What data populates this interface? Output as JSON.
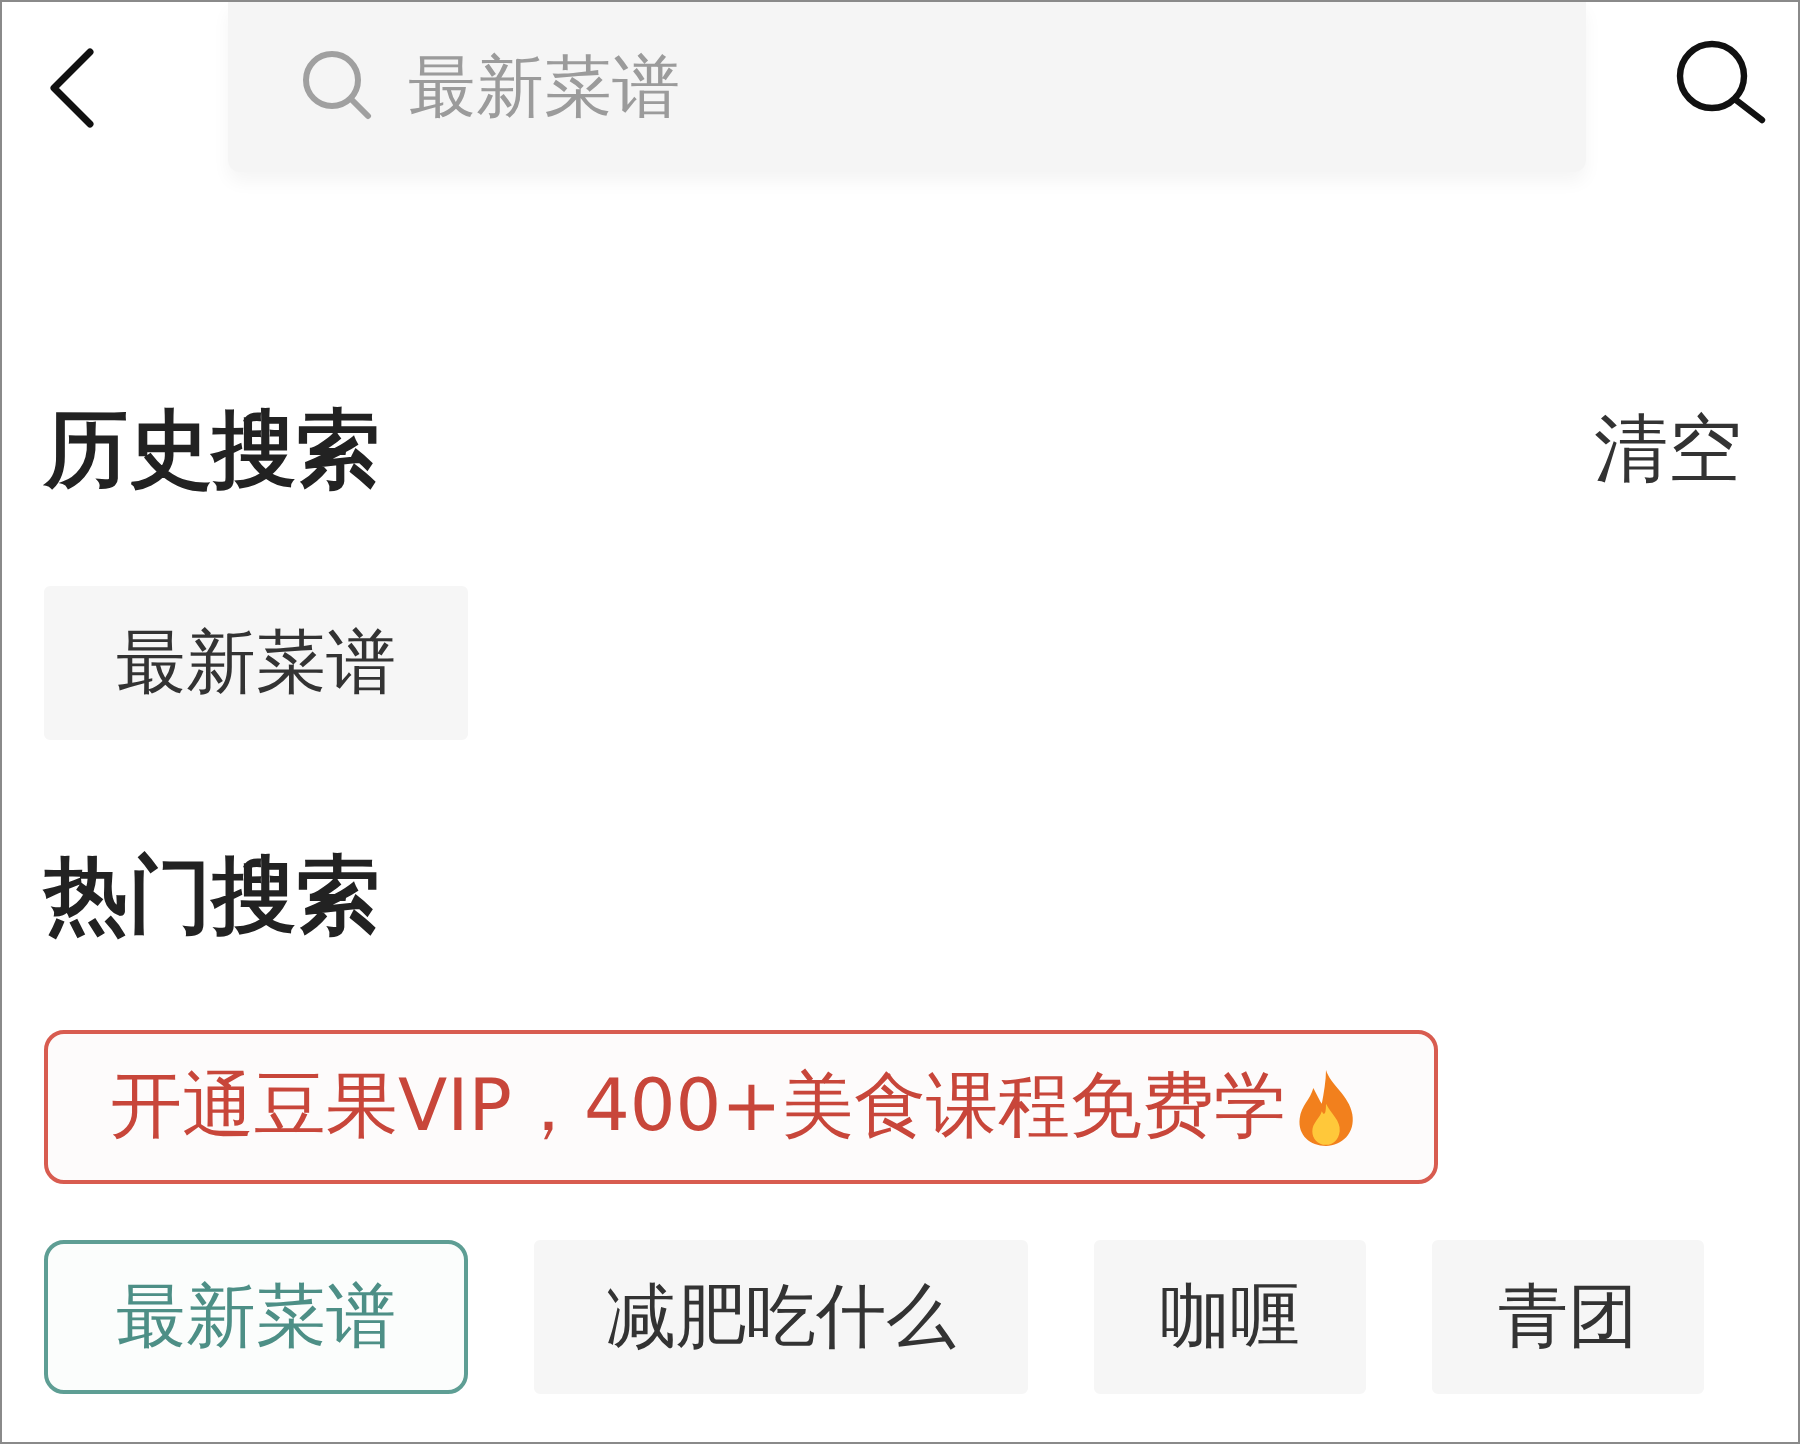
{
  "search_bar": {
    "placeholder": "最新菜谱"
  },
  "history": {
    "title": "历史搜索",
    "clear_label": "清空",
    "items": [
      {
        "label": "最新菜谱"
      }
    ]
  },
  "hot": {
    "title": "热门搜索",
    "promo": {
      "text": "开通豆果VIP，400+美食课程免费学"
    },
    "tags": [
      {
        "label": "最新菜谱",
        "highlighted": true
      },
      {
        "label": "减肥吃什么",
        "highlighted": false
      },
      {
        "label": "咖喱",
        "highlighted": false
      },
      {
        "label": "青团",
        "highlighted": false
      }
    ]
  }
}
